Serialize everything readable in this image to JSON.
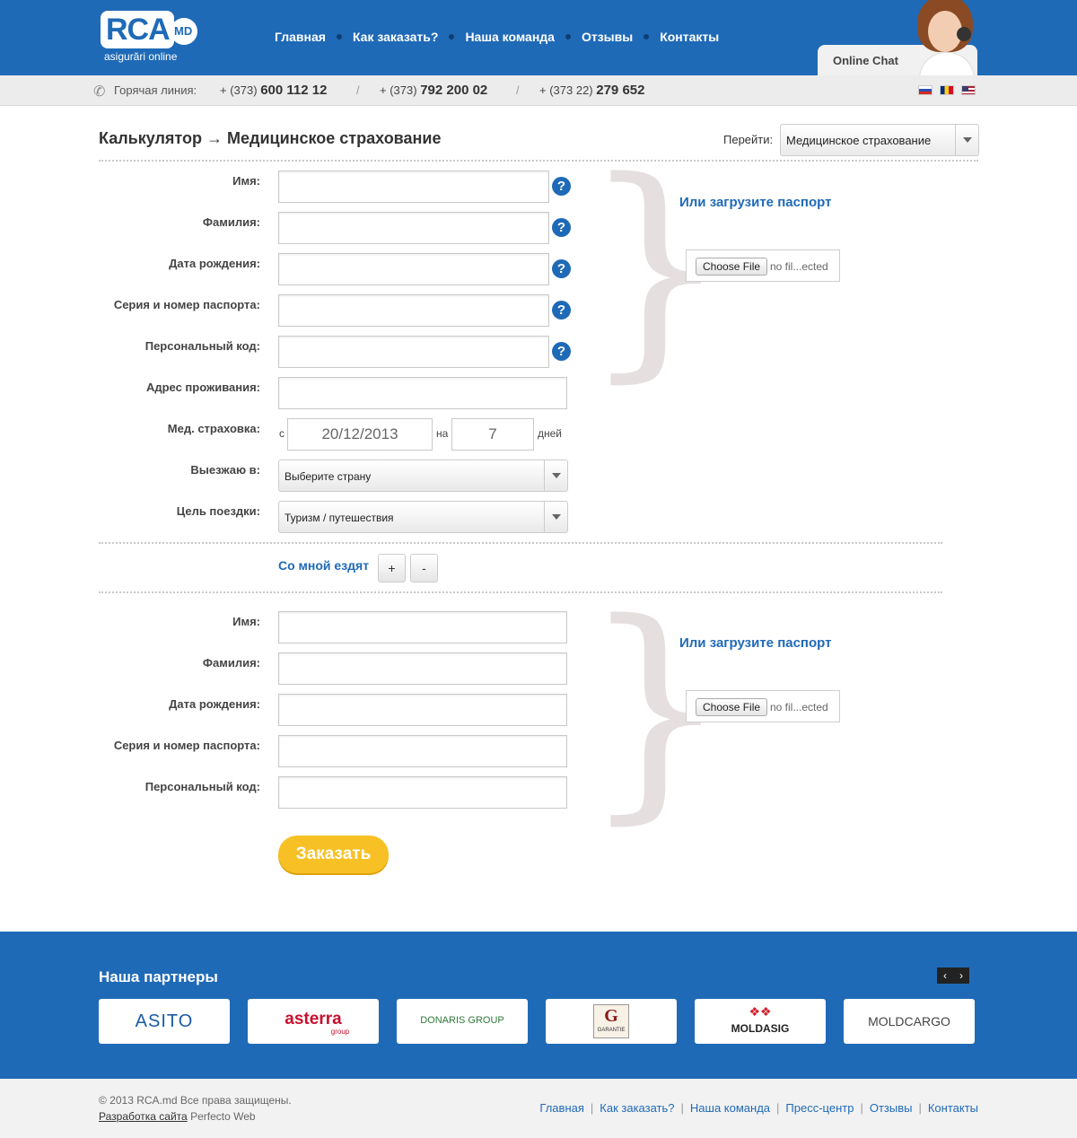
{
  "header": {
    "logo": "RCA",
    "logo_badge": "MD",
    "logo_sub": "asigurări online",
    "nav": [
      "Главная",
      "Как заказать?",
      "Наша команда",
      "Отзывы",
      "Контакты"
    ],
    "chat": "Online Chat"
  },
  "hotline": {
    "label": "Горячая линия:",
    "phones": [
      {
        "code": "+ (373)",
        "number": "600 112 12"
      },
      {
        "code": "+ (373)",
        "number": "792 200 02"
      },
      {
        "code": "+ (373 22)",
        "number": "279 652"
      }
    ],
    "separator": "/"
  },
  "page": {
    "title": "Калькулятор → Медицинское страхование",
    "goto_label": "Перейти:",
    "goto_value": "Медицинское страхование"
  },
  "form": {
    "labels": {
      "name": "Имя:",
      "surname": "Фамилия:",
      "birthdate": "Дата рождения:",
      "passport": "Серия и номер паспорта:",
      "personal_code": "Персональный код:",
      "address": "Адрес проживания:",
      "insurance": "Мед. страховка:",
      "country": "Выезжаю в:",
      "purpose": "Цель поездки:"
    },
    "help": "?",
    "upload_title": "Или загрузите паспорт",
    "file_button": "Choose File",
    "file_text": "no fil...ected",
    "from": "с",
    "date_value": "20/12/2013",
    "on": "на",
    "days_value": "7",
    "days": "дней",
    "country_value": "Выберите страну",
    "purpose_value": "Туризм / путешествия",
    "companions": "Со мной ездят",
    "plus": "+",
    "minus": "-",
    "order": "Заказать"
  },
  "partners": {
    "title": "Наша партнеры",
    "prev": "‹",
    "next": "›",
    "logos": [
      "ASITO",
      "asterra",
      "group",
      "DONARIS GROUP",
      "G",
      "GARANTIE",
      "MOLDASIG",
      "MOLDCARGO"
    ]
  },
  "footer": {
    "copyright": "© 2013 RCA.md Все права защищены.",
    "dev_link": "Разработка сайта",
    "dev_name": "Perfecto Web",
    "links": [
      "Главная",
      "Как заказать?",
      "Наша команда",
      "Пресс-центр",
      "Отзывы",
      "Контакты"
    ],
    "separator": "|"
  },
  "colors": {
    "brand": "#1f6ab7",
    "order_button": "#f7c125"
  }
}
